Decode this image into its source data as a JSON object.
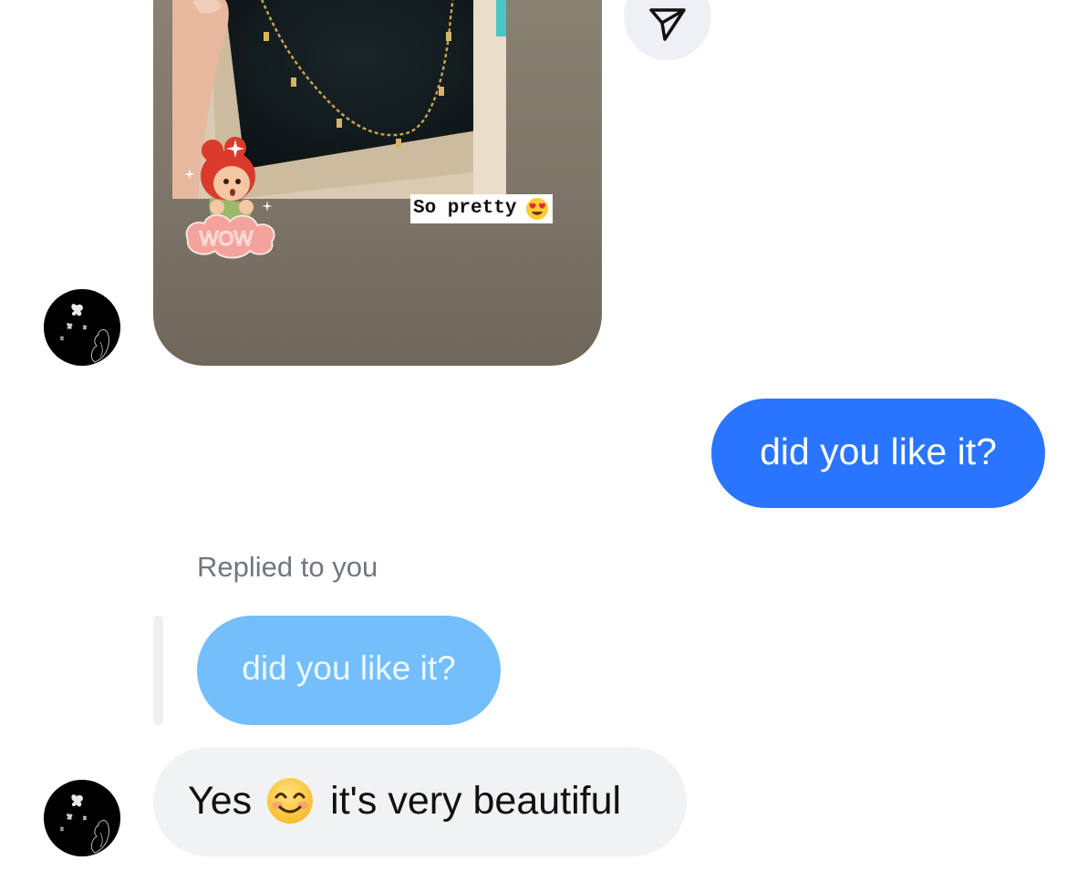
{
  "story": {
    "caption": "So pretty",
    "caption_emoji": "heart-eyes",
    "sticker_text": "WOW"
  },
  "actions": {
    "share_icon": "send-icon"
  },
  "messages": {
    "outgoing": "did you like it?",
    "replied_label": "Replied to you",
    "quoted": "did you like it?",
    "incoming_before_emoji": "Yes",
    "incoming_emoji": "smiling-face",
    "incoming_after_emoji": "it's very beautiful"
  },
  "colors": {
    "outgoing_bubble": "#2a75ff",
    "quoted_bubble": "#74bffb",
    "incoming_bubble": "#f1f2f4"
  }
}
